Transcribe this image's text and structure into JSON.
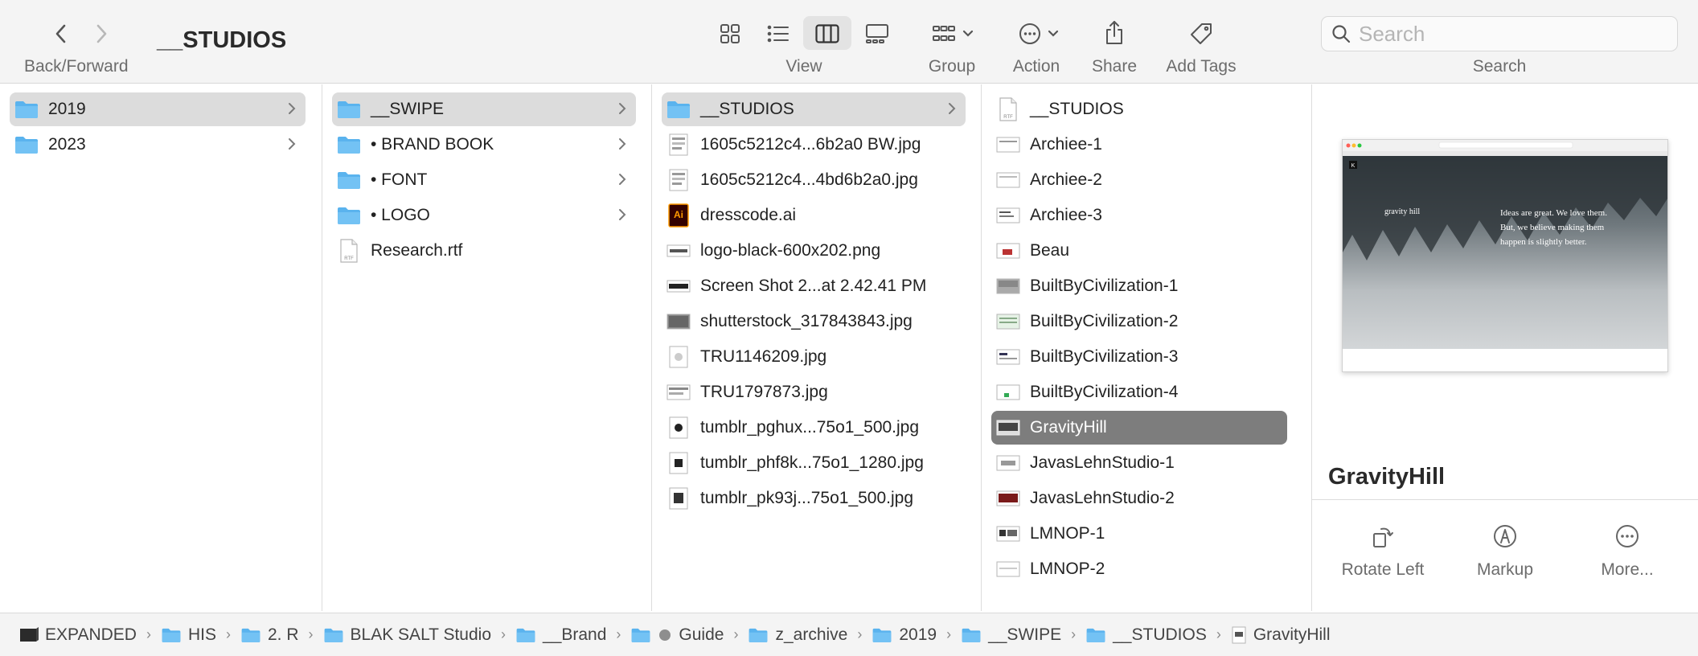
{
  "toolbar": {
    "back_forward_label": "Back/Forward",
    "title": "__STUDIOS",
    "view_label": "View",
    "group_label": "Group",
    "action_label": "Action",
    "share_label": "Share",
    "add_tags_label": "Add Tags",
    "search_label": "Search",
    "search_placeholder": "Search"
  },
  "columns": {
    "col1": [
      {
        "label": "2019",
        "icon": "folder-icon",
        "selected": true,
        "has_children": true
      },
      {
        "label": "2023",
        "icon": "folder-icon",
        "selected": false,
        "has_children": true
      }
    ],
    "col2": [
      {
        "label": "__SWIPE",
        "icon": "folder-icon",
        "selected": true,
        "has_children": true
      },
      {
        "label": "• BRAND BOOK",
        "icon": "folder-icon",
        "selected": false,
        "has_children": true
      },
      {
        "label": "• FONT",
        "icon": "folder-icon",
        "selected": false,
        "has_children": true
      },
      {
        "label": "• LOGO",
        "icon": "folder-icon",
        "selected": false,
        "has_children": true
      },
      {
        "label": "Research.rtf",
        "icon": "rtf-file-icon",
        "selected": false,
        "has_children": false
      }
    ],
    "col3": [
      {
        "label": "__STUDIOS",
        "icon": "folder-icon",
        "selected": true,
        "has_children": true
      },
      {
        "label": "1605c5212c4...6b2a0 BW.jpg",
        "icon": "image-file-icon"
      },
      {
        "label": "1605c5212c4...4bd6b2a0.jpg",
        "icon": "image-file-icon"
      },
      {
        "label": "dresscode.ai",
        "icon": "illustrator-file-icon"
      },
      {
        "label": "logo-black-600x202.png",
        "icon": "image-file-icon"
      },
      {
        "label": "Screen Shot 2...at 2.42.41 PM",
        "icon": "screenshot-file-icon"
      },
      {
        "label": "shutterstock_317843843.jpg",
        "icon": "image-file-icon"
      },
      {
        "label": "TRU1146209.jpg",
        "icon": "image-file-icon"
      },
      {
        "label": "TRU1797873.jpg",
        "icon": "image-file-icon"
      },
      {
        "label": "tumblr_pghux...75o1_500.jpg",
        "icon": "image-file-icon"
      },
      {
        "label": "tumblr_phf8k...75o1_1280.jpg",
        "icon": "image-file-icon"
      },
      {
        "label": "tumblr_pk93j...75o1_500.jpg",
        "icon": "image-file-icon"
      }
    ],
    "col4": [
      {
        "label": "__STUDIOS",
        "icon": "rtf-file-icon"
      },
      {
        "label": "Archiee-1",
        "icon": "image-file-icon"
      },
      {
        "label": "Archiee-2",
        "icon": "image-file-icon"
      },
      {
        "label": "Archiee-3",
        "icon": "image-file-icon"
      },
      {
        "label": "Beau",
        "icon": "image-file-icon"
      },
      {
        "label": "BuiltByCivilization-1",
        "icon": "image-file-icon"
      },
      {
        "label": "BuiltByCivilization-2",
        "icon": "image-file-icon"
      },
      {
        "label": "BuiltByCivilization-3",
        "icon": "image-file-icon"
      },
      {
        "label": "BuiltByCivilization-4",
        "icon": "image-file-icon"
      },
      {
        "label": "GravityHill",
        "icon": "image-file-icon",
        "selected": true
      },
      {
        "label": "JavasLehnStudio-1",
        "icon": "image-file-icon"
      },
      {
        "label": "JavasLehnStudio-2",
        "icon": "image-file-icon"
      },
      {
        "label": "LMNOP-1",
        "icon": "image-file-icon"
      },
      {
        "label": "LMNOP-2",
        "icon": "image-file-icon"
      }
    ]
  },
  "preview": {
    "name": "GravityHill",
    "thumb_logo": "gravity hill",
    "thumb_text_1": "Ideas are great. We love them.",
    "thumb_text_2": "But, we believe making them",
    "thumb_text_3": "happen is slightly better.",
    "actions": [
      {
        "label": "Rotate Left",
        "icon": "rotate-left-icon"
      },
      {
        "label": "Markup",
        "icon": "markup-icon"
      },
      {
        "label": "More...",
        "icon": "more-icon"
      }
    ]
  },
  "pathbar": [
    {
      "label": "EXPANDED",
      "icon": "drive-icon"
    },
    {
      "label": "HIS",
      "icon": "folder-icon"
    },
    {
      "label": "2. R",
      "icon": "folder-icon"
    },
    {
      "label": "BLAK SALT Studio",
      "icon": "folder-icon"
    },
    {
      "label": "__Brand",
      "icon": "folder-icon"
    },
    {
      "label": "Guide",
      "icon": "folder-icon",
      "tag": true
    },
    {
      "label": "z_archive",
      "icon": "folder-icon"
    },
    {
      "label": "2019",
      "icon": "folder-icon"
    },
    {
      "label": "__SWIPE",
      "icon": "folder-icon"
    },
    {
      "label": "__STUDIOS",
      "icon": "folder-icon"
    },
    {
      "label": "GravityHill",
      "icon": "image-file-icon"
    }
  ],
  "colors": {
    "folder": "#5ab3ee",
    "selection_light": "#dcdcdc",
    "selection_dark": "#7d7d7d"
  }
}
